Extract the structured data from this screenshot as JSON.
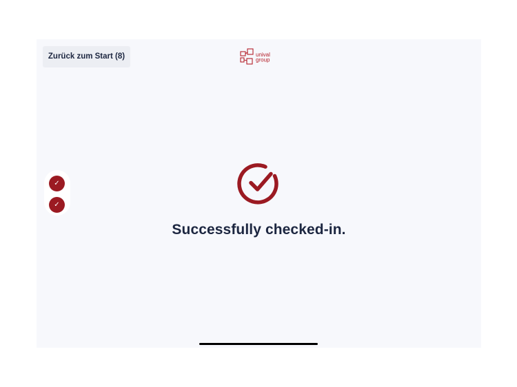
{
  "header": {
    "back_button_label": "Zurück zum Start (8)",
    "logo": {
      "text_line1": "unival",
      "text_line2": "group",
      "icon": "unival-group-logo-icon"
    }
  },
  "steps": [
    {
      "icon": "check-icon",
      "glyph": "✓",
      "status": "completed"
    },
    {
      "icon": "check-icon",
      "glyph": "✓",
      "status": "completed"
    }
  ],
  "main": {
    "status_icon": "check-circle-icon",
    "message": "Successfully checked-in."
  },
  "colors": {
    "accent": "#9b1a22",
    "text": "#1c2640",
    "background": "#f7f8fc",
    "button_background": "#eceef3"
  }
}
